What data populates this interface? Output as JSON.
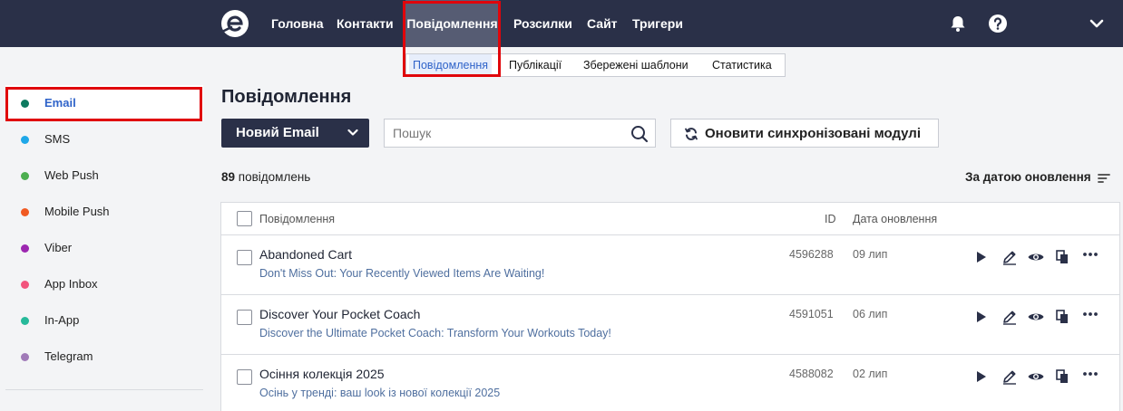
{
  "nav": {
    "items": [
      {
        "label": "Головна"
      },
      {
        "label": "Контакти"
      },
      {
        "label": "Повідомлення"
      },
      {
        "label": "Розсилки"
      },
      {
        "label": "Сайт"
      },
      {
        "label": "Тригери"
      }
    ],
    "active_index": 2,
    "icons": [
      "logo-icon",
      "bell-icon",
      "help-icon",
      "chevron-down-icon"
    ]
  },
  "subnav": {
    "items": [
      {
        "label": "Повідомлення"
      },
      {
        "label": "Публікації"
      },
      {
        "label": "Збережені шаблони"
      },
      {
        "label": "Статистика"
      }
    ],
    "active_index": 0
  },
  "sidebar": {
    "items": [
      {
        "label": "Email",
        "color": "#0d7a5f"
      },
      {
        "label": "SMS",
        "color": "#1ea7e8"
      },
      {
        "label": "Web Push",
        "color": "#4cae4f"
      },
      {
        "label": "Mobile Push",
        "color": "#f05a22"
      },
      {
        "label": "Viber",
        "color": "#9c27b0"
      },
      {
        "label": "App Inbox",
        "color": "#f2547d"
      },
      {
        "label": "In-App",
        "color": "#26b99a"
      },
      {
        "label": "Telegram",
        "color": "#a07ab8"
      }
    ],
    "active_index": 0
  },
  "main": {
    "title": "Повідомлення",
    "new_button": "Новий Email",
    "search_placeholder": "Пошук",
    "sync_button": "Оновити синхронізовані модулі",
    "count_number": "89",
    "count_text": "повідомлень",
    "sort_label": "За датою оновлення"
  },
  "table": {
    "headers": {
      "message": "Повідомлення",
      "id": "ID",
      "date": "Дата оновлення"
    },
    "rows": [
      {
        "name": "Abandoned Cart",
        "subject": "Don't Miss Out: Your Recently Viewed Items Are Waiting!",
        "id": "4596288",
        "date": "09 лип"
      },
      {
        "name": "Discover Your Pocket Coach",
        "subject": "Discover the Ultimate Pocket Coach: Transform Your Workouts Today!",
        "id": "4591051",
        "date": "06 лип"
      },
      {
        "name": "Осіння колекція 2025",
        "subject": "Осінь у тренді: ваш look із нової колекції 2025",
        "id": "4588082",
        "date": "02 лип"
      }
    ],
    "row_actions": [
      "play-icon",
      "edit-icon",
      "eye-icon",
      "copy-icon",
      "more-icon"
    ]
  },
  "colors": {
    "topbar": "#2a3048",
    "active_nav": "#565c73",
    "accent_blue": "#2f63c9",
    "highlight": "#e0050b"
  }
}
